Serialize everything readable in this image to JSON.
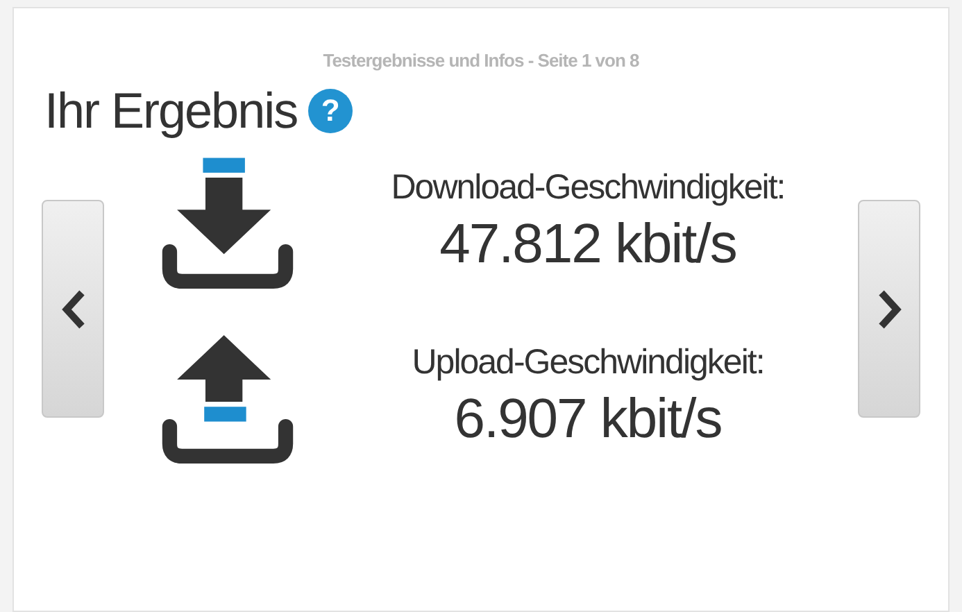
{
  "subtitle": "Testergebnisse und Infos - Seite 1 von 8",
  "title": "Ihr Ergebnis",
  "help_icon": "?",
  "results": [
    {
      "kind": "download",
      "label": "Download-Geschwindigkeit:",
      "value": "47.812 kbit/s"
    },
    {
      "kind": "upload",
      "label": "Upload-Geschwindigkeit:",
      "value": "6.907 kbit/s"
    }
  ]
}
